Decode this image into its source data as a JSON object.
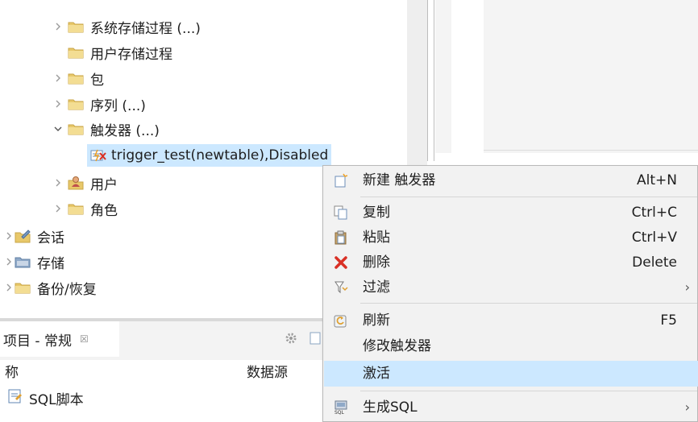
{
  "tree": {
    "items": [
      {
        "label": "系统存储过程 (...)"
      },
      {
        "label": "用户存储过程"
      },
      {
        "label": "包"
      },
      {
        "label": "序列 (...)"
      },
      {
        "label": "触发器 (...)"
      },
      {
        "label": "trigger_test(newtable),Disabled"
      },
      {
        "label": "用户"
      },
      {
        "label": "角色"
      },
      {
        "label": "会话"
      },
      {
        "label": "存储"
      },
      {
        "label": "备份/恢复"
      }
    ]
  },
  "project_view": {
    "tab_label": "项目 - 常规",
    "tab_close": "☒",
    "columns": [
      "称",
      "数据源"
    ],
    "rows": [
      {
        "name": "SQL脚本"
      }
    ]
  },
  "context_menu": {
    "items": [
      {
        "label": "新建 触发器",
        "shortcut": "Alt+N"
      },
      {
        "label": "复制",
        "shortcut": "Ctrl+C"
      },
      {
        "label": "粘贴",
        "shortcut": "Ctrl+V"
      },
      {
        "label": "删除",
        "shortcut": "Delete"
      },
      {
        "label": "过滤",
        "arrow": "›"
      },
      {
        "label": "刷新",
        "shortcut": "F5"
      },
      {
        "label": "修改触发器"
      },
      {
        "label": "激活"
      },
      {
        "label": "生成SQL",
        "arrow": "›"
      }
    ]
  },
  "colors": {
    "selection": "#cce8ff",
    "folder": "#e8c86a",
    "delete_red": "#d93025"
  }
}
